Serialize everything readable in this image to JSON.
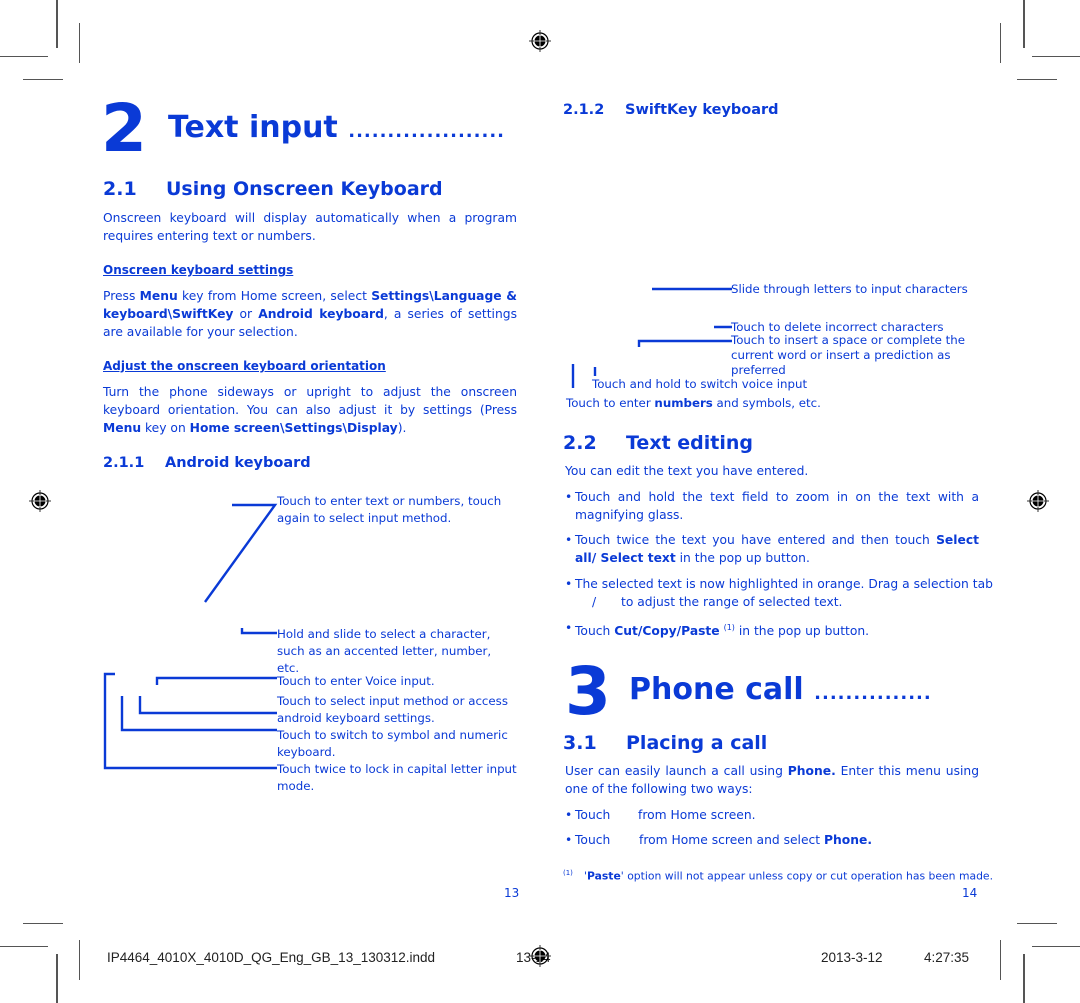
{
  "left_page": {
    "chapter": {
      "number": "2",
      "title": "Text input",
      "leader": "...................."
    },
    "section_2_1": {
      "number": "2.1",
      "title": "Using Onscreen Keyboard",
      "intro": "Onscreen keyboard will display automatically when a program requires entering text or numbers."
    },
    "keyboard_settings": {
      "heading": "Onscreen keyboard settings",
      "text_parts": {
        "a": "Press ",
        "b": "Menu",
        "c": " key from Home screen, select ",
        "d": "Settings\\Language & keyboard\\SwiftKey",
        "e": " or ",
        "f": "Android keyboard",
        "g": ", a series of settings are available for your selection."
      }
    },
    "orientation": {
      "heading": "Adjust the onscreen keyboard orientation",
      "text_parts": {
        "a": "Turn the phone sideways or upright to adjust the onscreen keyboard orientation. You can also adjust it by settings (Press ",
        "b": "Menu",
        "c": " key on ",
        "d": "Home screen\\Settings\\Display",
        "e": ")."
      }
    },
    "section_2_1_1": {
      "number": "2.1.1",
      "title": "Android keyboard",
      "callouts": [
        "Touch to enter text or numbers, touch again to select input method.",
        "Hold and slide to select a character, such as an accented letter, number, etc.",
        "Touch to enter Voice input.",
        "Touch to select input method or access android keyboard settings.",
        "Touch to switch to symbol and numeric keyboard.",
        "Touch twice to lock in capital letter input mode."
      ]
    },
    "page_number": "13"
  },
  "right_page": {
    "section_2_1_2": {
      "number": "2.1.2",
      "title": "SwiftKey keyboard",
      "callouts": [
        "Slide through letters to input characters",
        "Touch to delete incorrect characters",
        "Touch to insert a space or complete the current word or insert a prediction as preferred",
        "Touch and hold to switch voice input"
      ],
      "numbers_callout": {
        "a": "Touch to enter ",
        "b": "numbers",
        "c": " and symbols, etc."
      }
    },
    "section_2_2": {
      "number": "2.2",
      "title": "Text editing",
      "intro": "You can edit the text you have entered.",
      "bullets": {
        "b1": "Touch and hold the text field to zoom in on the text with a magnifying glass.",
        "b2": {
          "a": "Touch twice the text you have entered and then touch ",
          "b": "Select all/ Select text",
          "c": " in the pop up button."
        },
        "b3": {
          "a": "The selected text is now highlighted in orange. Drag a selection tab",
          "b": "/",
          "c": "to adjust the range of selected text."
        },
        "b4": {
          "a": "Touch ",
          "b": "Cut/Copy/Paste",
          "sup": "(1)",
          "c": " in the pop up button."
        }
      }
    },
    "chapter": {
      "number": "3",
      "title": "Phone call",
      "leader": "..............."
    },
    "section_3_1": {
      "number": "3.1",
      "title": "Placing a call",
      "intro": {
        "a": "User can easily launch a call using ",
        "b": "Phone.",
        "c": " Enter this menu using one of the following two ways:"
      },
      "bullets": {
        "b1": {
          "a": "Touch",
          "b": "from Home screen."
        },
        "b2": {
          "a": "Touch",
          "b": "from Home screen and select ",
          "c": "Phone."
        }
      }
    },
    "footnote": {
      "marker": "(1)",
      "a": "'",
      "b": "Paste",
      "c": "' option will not appear unless copy or cut operation has been made."
    },
    "page_number": "14"
  },
  "slug": {
    "filename": "IP4464_4010X_4010D_QG_Eng_GB_13_130312.indd",
    "pages": "13-14",
    "date": "2013-3-12",
    "time": "4:27:35"
  },
  "bullet_char": "•",
  "colors": {
    "text_blue": "#0a3ad6",
    "crop_marks": "#555555"
  }
}
